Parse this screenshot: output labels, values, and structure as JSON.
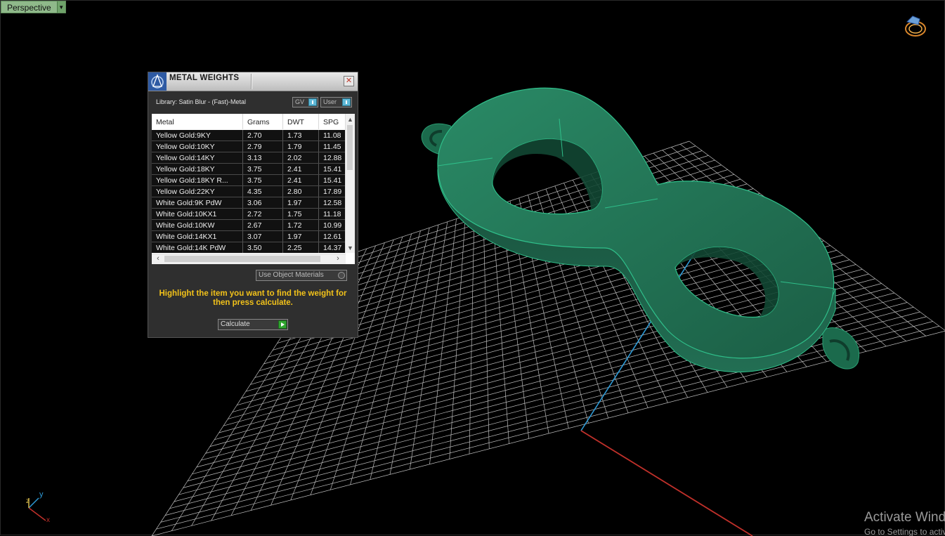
{
  "viewport": {
    "label": "Perspective",
    "axis_labels": {
      "x": "x",
      "y": "y",
      "z": "z"
    }
  },
  "panel": {
    "title": "METAL WEIGHTS",
    "library": "Library: Satin Blur - (Fast)-Metal",
    "toggles": [
      "GV",
      "User"
    ],
    "columns": [
      "Metal",
      "Grams",
      "DWT",
      "SPG"
    ],
    "rows": [
      [
        "Yellow Gold:9KY",
        "2.70",
        "1.73",
        "11.08"
      ],
      [
        "Yellow Gold:10KY",
        "2.79",
        "1.79",
        "11.45"
      ],
      [
        "Yellow Gold:14KY",
        "3.13",
        "2.02",
        "12.88"
      ],
      [
        "Yellow Gold:18KY",
        "3.75",
        "2.41",
        "15.41"
      ],
      [
        "Yellow Gold:18KY R...",
        "3.75",
        "2.41",
        "15.41"
      ],
      [
        "Yellow Gold:22KY",
        "4.35",
        "2.80",
        "17.89"
      ],
      [
        "White Gold:9K PdW",
        "3.06",
        "1.97",
        "12.58"
      ],
      [
        "White Gold:10KX1",
        "2.72",
        "1.75",
        "11.18"
      ],
      [
        "White Gold:10KW",
        "2.67",
        "1.72",
        "10.99"
      ],
      [
        "White Gold:14KX1",
        "3.07",
        "1.97",
        "12.61"
      ],
      [
        "White Gold:14K PdW",
        "3.50",
        "2.25",
        "14.37"
      ]
    ],
    "use_object_materials": "Use Object Materials",
    "hint": "Highlight the item you want to find the weight for then press calculate.",
    "calculate": "Calculate"
  },
  "watermark": {
    "line1": "Activate Windows",
    "line2": "Go to Settings to activate Windows."
  },
  "colors": {
    "model": "#1e6b4f",
    "model_edge": "#2fbf8a",
    "grid": "#cfcfcf",
    "axis_x": "#c0302a",
    "axis_y": "#2e9ad6",
    "hint": "#f2c21a"
  }
}
